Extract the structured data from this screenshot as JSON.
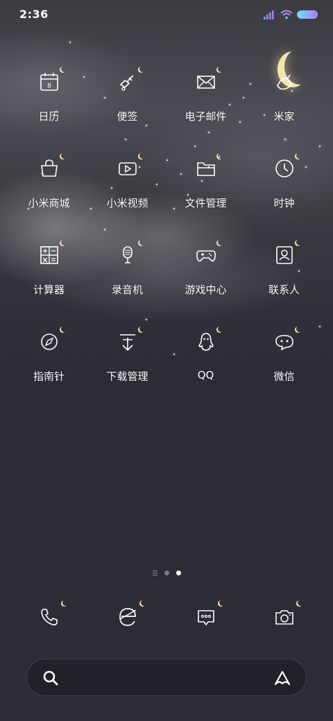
{
  "status_bar": {
    "time": "2:36",
    "icons": [
      "signal-icon",
      "wifi-icon",
      "battery-icon"
    ],
    "battery_colors": [
      "#5ee6ff",
      "#a67bff"
    ]
  },
  "apps": [
    {
      "label": "日历",
      "icon": "calendar-icon",
      "calendar_day": "8"
    },
    {
      "label": "便签",
      "icon": "notes-icon"
    },
    {
      "label": "电子邮件",
      "icon": "mail-icon"
    },
    {
      "label": "米家",
      "icon": "mijia-icon"
    },
    {
      "label": "小米商城",
      "icon": "shopping-bag-icon"
    },
    {
      "label": "小米视频",
      "icon": "video-play-icon"
    },
    {
      "label": "文件管理",
      "icon": "folder-icon"
    },
    {
      "label": "时钟",
      "icon": "clock-icon"
    },
    {
      "label": "计算器",
      "icon": "calculator-icon"
    },
    {
      "label": "录音机",
      "icon": "microphone-icon"
    },
    {
      "label": "游戏中心",
      "icon": "gamepad-icon"
    },
    {
      "label": "联系人",
      "icon": "contacts-icon"
    },
    {
      "label": "指南针",
      "icon": "compass-icon"
    },
    {
      "label": "下载管理",
      "icon": "download-icon"
    },
    {
      "label": "QQ",
      "icon": "qq-penguin-icon"
    },
    {
      "label": "微信",
      "icon": "wechat-icon"
    }
  ],
  "pager": {
    "page_count": 2,
    "active_page": 2
  },
  "dock": [
    {
      "icon": "phone-icon"
    },
    {
      "icon": "browser-icon"
    },
    {
      "icon": "messages-icon"
    },
    {
      "icon": "camera-icon"
    }
  ],
  "search_bar": {
    "left_icon": "search-icon",
    "right_icon": "xiaoai-icon"
  },
  "theme": {
    "background": "#2b2c35",
    "moon_color": "#f4e4b0",
    "icon_stroke": "#ffffff"
  }
}
